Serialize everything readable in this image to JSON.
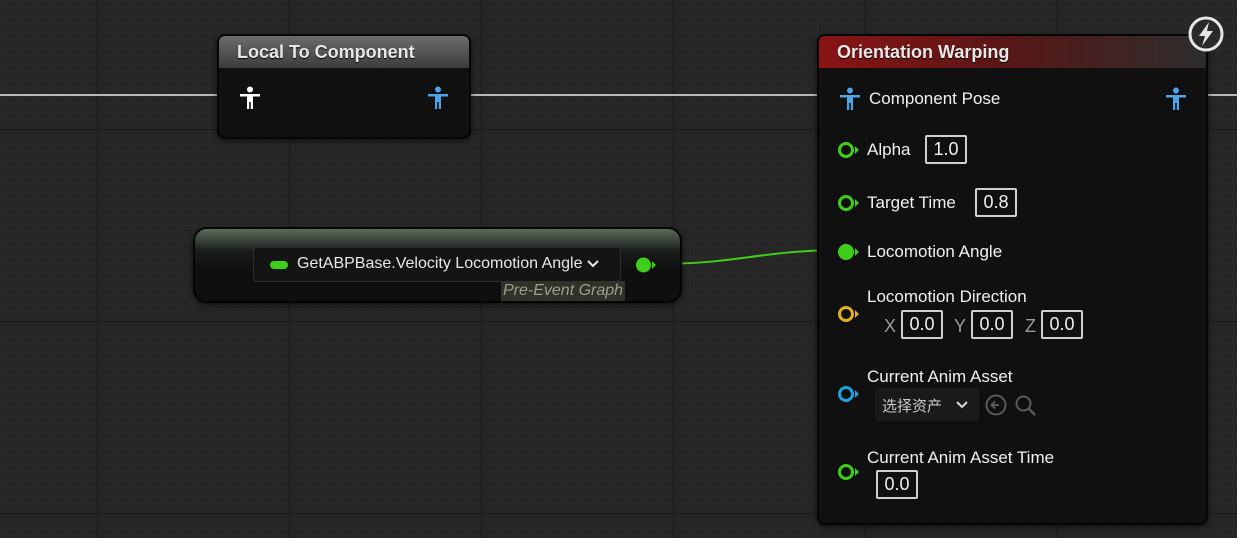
{
  "nodes": {
    "local_to_component": {
      "title": "Local To Component"
    },
    "getter": {
      "label": "GetABPBase.Velocity Locomotion Angle",
      "context": "Pre-Event Graph"
    },
    "orientation_warping": {
      "title": "Orientation Warping",
      "pins": {
        "component_pose": "Component Pose",
        "alpha": "Alpha",
        "alpha_value": "1.0",
        "target_time": "Target Time",
        "target_time_value": "0.8",
        "locomotion_angle": "Locomotion Angle",
        "locomotion_direction": "Locomotion Direction",
        "x_label": "X",
        "x_value": "0.0",
        "y_label": "Y",
        "y_value": "0.0",
        "z_label": "Z",
        "z_value": "0.0",
        "current_anim_asset": "Current Anim Asset",
        "asset_picker": "选择资产",
        "current_anim_asset_time": "Current Anim Asset Time",
        "asset_time_value": "0.0"
      }
    }
  },
  "colors": {
    "pose_pin": "#4fa3e8",
    "float_pin": "#3fcf1a",
    "vector_pin": "#e0b020",
    "object_pin": "#1fa0e0",
    "orientation_header": "#8a1414"
  }
}
